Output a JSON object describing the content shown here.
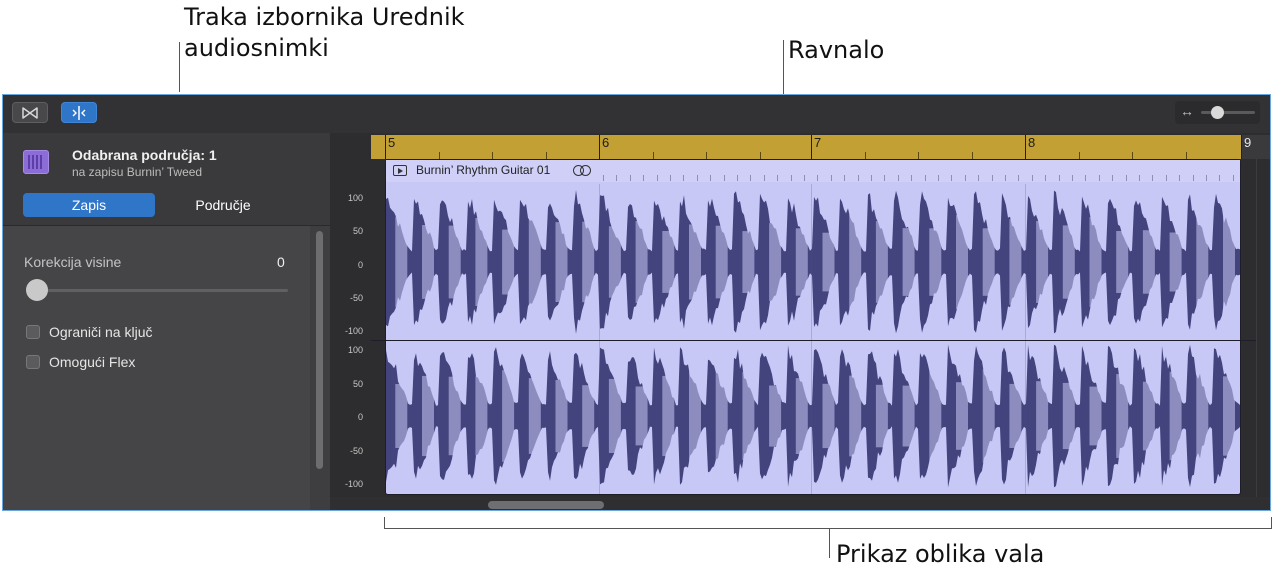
{
  "callouts": {
    "menu_bar_line1": "Traka izbornika Urednik",
    "menu_bar_line2": "audiosnimki",
    "ruler": "Ravnalo",
    "waveform": "Prikaz oblika vala"
  },
  "toolbar": {
    "left_button_icon": "bowtie-icon",
    "flex_button_icon": "flex-icon",
    "zoom_icon": "horizontal-arrows-icon",
    "zoom_level": 0.3
  },
  "inspector": {
    "title": "Odabrana područja: 1",
    "subtitle": "na zapisu Burnin’ Tweed",
    "tabs": [
      {
        "label": "Zapis",
        "selected": true
      },
      {
        "label": "Područje",
        "selected": false
      }
    ],
    "pitch_label": "Korekcija visine",
    "pitch_value": "0",
    "pitch_slider": 0,
    "checkboxes": [
      {
        "label": "Ograniči na ključ",
        "checked": false
      },
      {
        "label": "Omogući Flex",
        "checked": false
      }
    ]
  },
  "ruler": {
    "bars": [
      "5",
      "6",
      "7",
      "8",
      "9"
    ]
  },
  "region": {
    "name": "Burnin’ Rhythm Guitar 01"
  },
  "y_axis": {
    "channel_ticks": [
      "100",
      "50",
      "0",
      "-50",
      "-100"
    ]
  },
  "colors": {
    "accent": "#2f75c8",
    "ruler": "#c2a033",
    "region_fill": "#c8c8f6",
    "waveform": "#43437d"
  }
}
